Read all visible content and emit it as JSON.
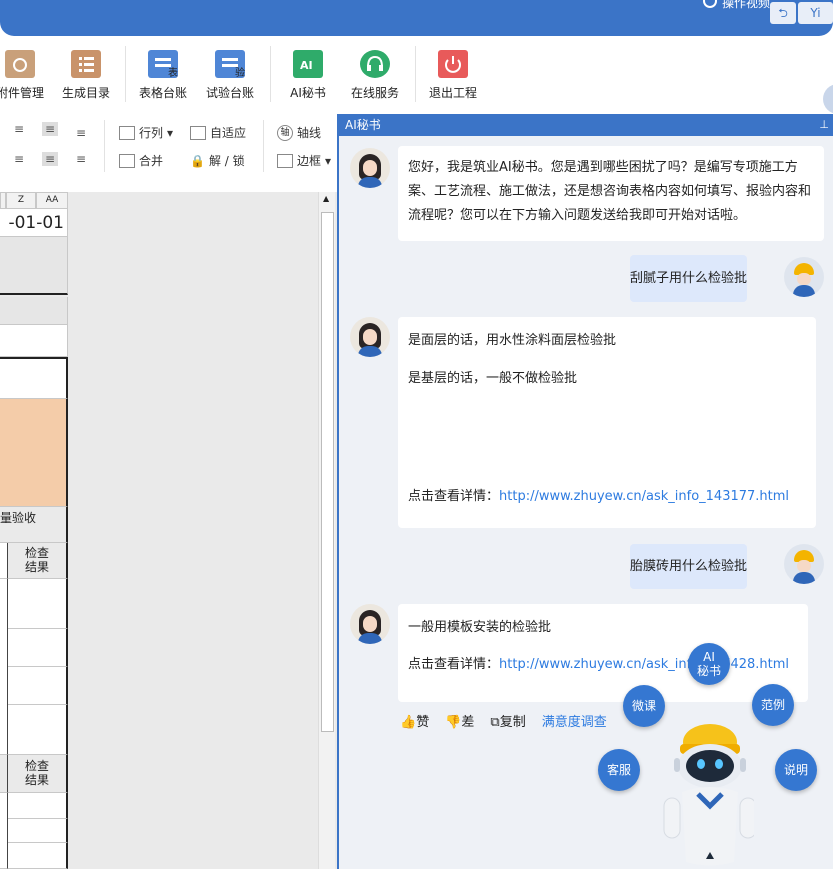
{
  "topbar": {
    "help_text": "操作视频",
    "corner_btn_1": "⮌",
    "corner_btn_2": "Yi"
  },
  "ribbon": {
    "items": [
      {
        "label": "附件管理",
        "icon": "paperclip-folder-icon",
        "color": "#c9a07a"
      },
      {
        "label": "生成目录",
        "icon": "list-icon",
        "color": "#c9936a"
      },
      {
        "label": "表格台账",
        "icon": "ledger-icon",
        "color": "#4f86d6"
      },
      {
        "label": "试验台账",
        "icon": "test-ledger-icon",
        "color": "#4f86d6"
      },
      {
        "label": "AI秘书",
        "icon": "ai-icon",
        "color": "#2fab6a"
      },
      {
        "label": "在线服务",
        "icon": "headset-icon",
        "color": "#2fab6a"
      },
      {
        "label": "退出工程",
        "icon": "power-icon",
        "color": "#e85a5a"
      }
    ],
    "user_id": "1389"
  },
  "format_toolbar": {
    "row_col": "行列",
    "autofit": "自适应",
    "axis": "轴线",
    "merge": "合并",
    "unlock": "解 / 锁",
    "border": "边框"
  },
  "sheet": {
    "col_z": "Z",
    "col_aa": "AA",
    "date_cell": "-01-01",
    "quality_text": "量验收",
    "check_result_1": "检查\n结果",
    "check_result_2": "检查\n结果"
  },
  "ai_panel": {
    "title": "AI秘书",
    "pin": "⊥",
    "greeting": "您好，我是筑业AI秘书。您是遇到哪些困扰了吗？是编写专项施工方案、工艺流程、施工做法，还是想咨询表格内容如何填写、报验内容和流程呢？您可以在下方输入问题发送给我即可开始对话啦。",
    "q1": "刮腻子用什么检验批",
    "a1_line1": "是面层的话，用水性涂料面层检验批",
    "a1_line2": "是基层的话，一般不做检验批",
    "a1_detail_label": "点击查看详情：",
    "a1_link": "http://www.zhuyew.cn/ask_info_143177.html",
    "q2": "胎膜砖用什么检验批",
    "a2_line1": "一般用模板安装的检验批",
    "a2_detail_label": "点击查看详情：",
    "a2_link": "http://www.zhuyew.cn/ask_info_117428.html",
    "like": "赞",
    "dislike": "差",
    "copy": "复制",
    "satisfaction": "满意度调查"
  },
  "fab_menu": {
    "ai": "AI\n秘书",
    "micro_course": "微课",
    "example": "范例",
    "support": "客服",
    "manual": "说明"
  }
}
